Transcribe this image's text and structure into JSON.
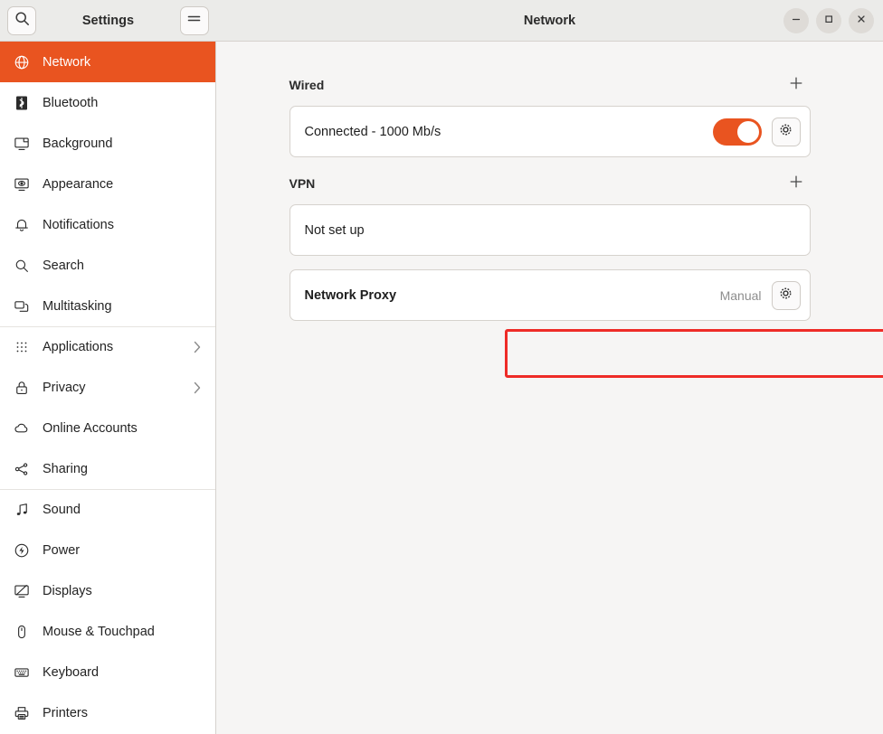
{
  "window": {
    "title": "Network",
    "app_title": "Settings",
    "controls": [
      {
        "name": "minimize",
        "glyph": "–"
      },
      {
        "name": "maximize",
        "glyph": "□"
      },
      {
        "name": "close",
        "glyph": "×"
      }
    ],
    "search_icon": "search-icon",
    "menu_icon": "hamburger-menu-icon"
  },
  "sidebar": {
    "items": [
      {
        "label": "Network",
        "icon": "globe-icon",
        "active": true,
        "chevron": false,
        "separator_above": false
      },
      {
        "label": "Bluetooth",
        "icon": "bluetooth-icon",
        "active": false,
        "chevron": false,
        "separator_above": false
      },
      {
        "label": "Background",
        "icon": "display-icon",
        "active": false,
        "chevron": false,
        "separator_above": false
      },
      {
        "label": "Appearance",
        "icon": "appearance-icon",
        "active": false,
        "chevron": false,
        "separator_above": false
      },
      {
        "label": "Notifications",
        "icon": "bell-icon",
        "active": false,
        "chevron": false,
        "separator_above": false
      },
      {
        "label": "Search",
        "icon": "search-icon",
        "active": false,
        "chevron": false,
        "separator_above": false
      },
      {
        "label": "Multitasking",
        "icon": "windows-icon",
        "active": false,
        "chevron": false,
        "separator_above": false
      },
      {
        "label": "Applications",
        "icon": "grid-icon",
        "active": false,
        "chevron": true,
        "separator_above": true
      },
      {
        "label": "Privacy",
        "icon": "lock-icon",
        "active": false,
        "chevron": true,
        "separator_above": false
      },
      {
        "label": "Online Accounts",
        "icon": "cloud-icon",
        "active": false,
        "chevron": false,
        "separator_above": false
      },
      {
        "label": "Sharing",
        "icon": "share-icon",
        "active": false,
        "chevron": false,
        "separator_above": false
      },
      {
        "label": "Sound",
        "icon": "music-note-icon",
        "active": false,
        "chevron": false,
        "separator_above": true
      },
      {
        "label": "Power",
        "icon": "power-icon",
        "active": false,
        "chevron": false,
        "separator_above": false
      },
      {
        "label": "Displays",
        "icon": "displays-icon",
        "active": false,
        "chevron": false,
        "separator_above": false
      },
      {
        "label": "Mouse & Touchpad",
        "icon": "mouse-icon",
        "active": false,
        "chevron": false,
        "separator_above": false
      },
      {
        "label": "Keyboard",
        "icon": "keyboard-icon",
        "active": false,
        "chevron": false,
        "separator_above": false
      },
      {
        "label": "Printers",
        "icon": "printer-icon",
        "active": false,
        "chevron": false,
        "separator_above": false
      }
    ]
  },
  "main": {
    "wired": {
      "title": "Wired",
      "add_label": "+",
      "status": "Connected - 1000 Mb/s",
      "toggle_on": true,
      "settings_icon": "gear-icon"
    },
    "vpn": {
      "title": "VPN",
      "add_label": "+",
      "status": "Not set up"
    },
    "proxy": {
      "title": "Network Proxy",
      "value": "Manual",
      "settings_icon": "gear-icon"
    }
  },
  "annotations": {
    "highlight_color": "#ee2b27",
    "arrow_color": "#f4321f",
    "highlight_target": "network-proxy-row",
    "arrow_target": "proxy-gear-button"
  },
  "colors": {
    "accent": "#e95420",
    "sidebar_bg": "#ffffff",
    "content_bg": "#f6f5f4",
    "header_bg": "#ebebe9"
  }
}
